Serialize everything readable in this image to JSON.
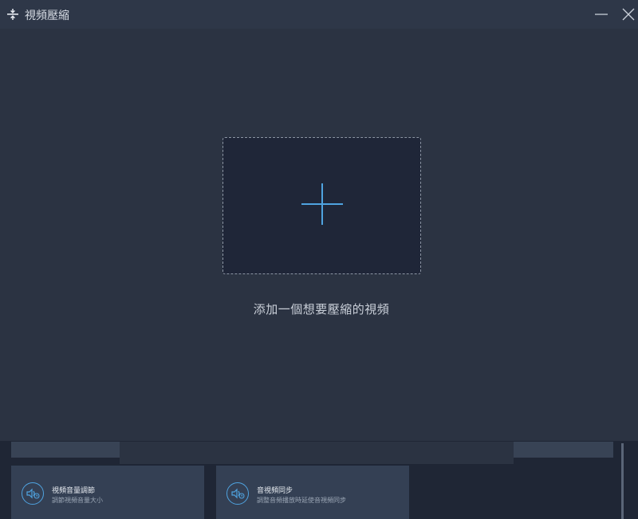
{
  "window": {
    "title": "視頻壓縮",
    "icon": "compress-icon",
    "controls": {
      "minimize": "minimize-icon",
      "close": "close-icon"
    }
  },
  "drop_zone": {
    "icon": "plus-icon",
    "caption": "添加一個想要壓縮的視頻"
  },
  "background_tools": [
    {
      "title": "視頻音量調節",
      "description": "調節視頻音量大小",
      "icon": "volume-icon"
    },
    {
      "title": "音視頻同步",
      "description": "調整音頻播放時延使音視頻同步",
      "icon": "audio-sync-icon"
    }
  ],
  "colors": {
    "accent": "#4fa3e0",
    "dialog_bg": "#2b3342",
    "drop_zone_bg": "#1f2638",
    "app_bg": "#1f2635"
  }
}
